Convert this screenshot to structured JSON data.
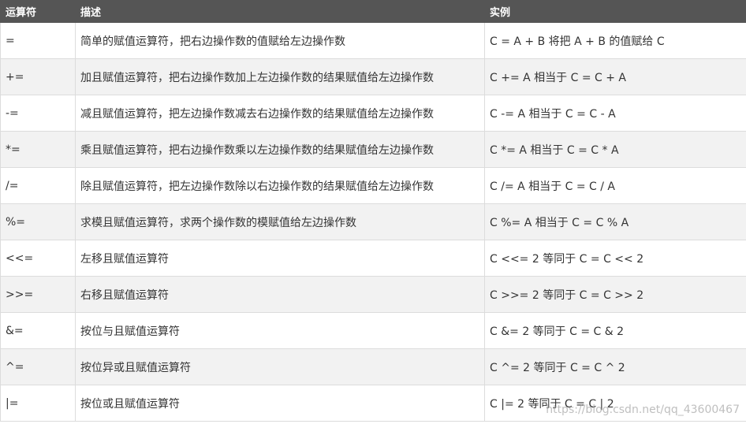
{
  "table": {
    "headers": [
      "运算符",
      "描述",
      "实例"
    ],
    "rows": [
      {
        "op": "=",
        "desc": "简单的赋值运算符，把右边操作数的值赋给左边操作数",
        "example": "C = A + B 将把 A + B 的值赋给 C"
      },
      {
        "op": "+=",
        "desc": "加且赋值运算符，把右边操作数加上左边操作数的结果赋值给左边操作数",
        "example": "C += A 相当于 C = C + A"
      },
      {
        "op": "-=",
        "desc": "减且赋值运算符，把左边操作数减去右边操作数的结果赋值给左边操作数",
        "example": "C -= A 相当于 C = C - A"
      },
      {
        "op": "*=",
        "desc": "乘且赋值运算符，把右边操作数乘以左边操作数的结果赋值给左边操作数",
        "example": "C *= A 相当于 C = C * A"
      },
      {
        "op": "/=",
        "desc": "除且赋值运算符，把左边操作数除以右边操作数的结果赋值给左边操作数",
        "example": "C /= A 相当于 C = C / A"
      },
      {
        "op": "%=",
        "desc": "求模且赋值运算符，求两个操作数的模赋值给左边操作数",
        "example": "C %= A 相当于 C = C % A"
      },
      {
        "op": "<<=",
        "desc": "左移且赋值运算符",
        "example": "C <<= 2 等同于 C = C << 2"
      },
      {
        "op": ">>=",
        "desc": "右移且赋值运算符",
        "example": "C >>= 2 等同于 C = C >> 2"
      },
      {
        "op": "&=",
        "desc": "按位与且赋值运算符",
        "example": "C &= 2 等同于 C = C & 2"
      },
      {
        "op": "^=",
        "desc": "按位异或且赋值运算符",
        "example": "C ^= 2 等同于 C = C ^ 2"
      },
      {
        "op": "|=",
        "desc": "按位或且赋值运算符",
        "example": "C |= 2 等同于 C = C | 2"
      }
    ]
  },
  "watermark": "https://blog.csdn.net/qq_43600467",
  "colors": {
    "header_bg": "#555555",
    "header_text": "#ffffff",
    "row_alt_bg": "#f2f2f2",
    "border": "#dcdcdc"
  }
}
